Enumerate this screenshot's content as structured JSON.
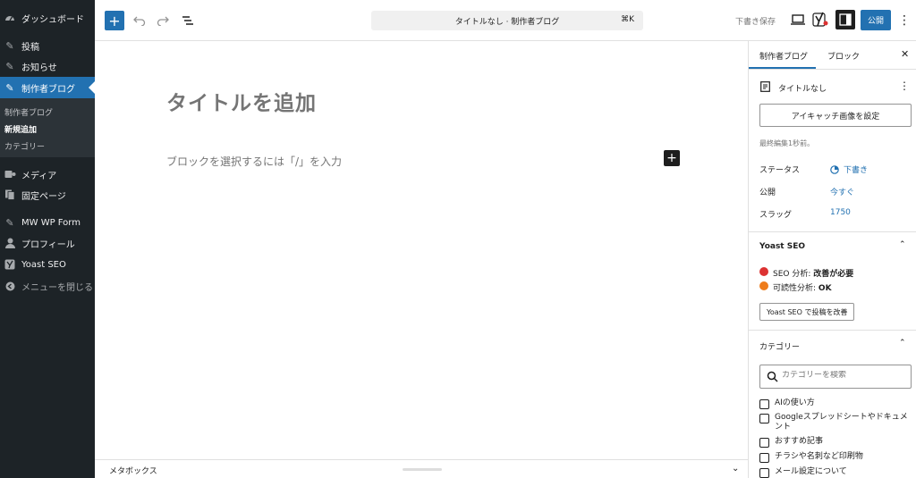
{
  "admin_menu": {
    "items": [
      {
        "label": "ダッシュボード",
        "icon": "dashboard-icon"
      },
      {
        "label": "投稿",
        "icon": "pin-icon"
      },
      {
        "label": "お知らせ",
        "icon": "pin-icon"
      },
      {
        "label": "制作者ブログ",
        "icon": "pin-icon",
        "active": true
      },
      {
        "label": "メディア",
        "icon": "media-icon"
      },
      {
        "label": "固定ページ",
        "icon": "page-icon"
      },
      {
        "label": "MW WP Form",
        "icon": "pin-icon"
      },
      {
        "label": "プロフィール",
        "icon": "user-icon"
      },
      {
        "label": "Yoast SEO",
        "icon": "yoast-icon"
      },
      {
        "label": "メニューを閉じる",
        "icon": "collapse-icon"
      }
    ],
    "submenu": [
      {
        "label": "制作者ブログ"
      },
      {
        "label": "新規追加",
        "current": true
      },
      {
        "label": "カテゴリー"
      }
    ]
  },
  "toolbar": {
    "document_title": "タイトルなし · 制作者ブログ",
    "shortcut": "⌘K",
    "save_draft": "下書き保存",
    "publish": "公開"
  },
  "canvas": {
    "title_placeholder": "タイトルを追加",
    "block_placeholder": "ブロックを選択するには「/」を入力"
  },
  "metabox": {
    "label": "メタボックス"
  },
  "sidebar": {
    "tabs": [
      "制作者ブログ",
      "ブロック"
    ],
    "post_title": "タイトルなし",
    "featured_image_button": "アイキャッチ画像を設定",
    "last_edited": "最終編集1秒前。",
    "status_label": "ステータス",
    "status_value": "下書き",
    "publish_label": "公開",
    "publish_value": "今すぐ",
    "slug_label": "スラッグ",
    "slug_value": "1750",
    "yoast": {
      "title": "Yoast SEO",
      "seo_label": "SEO 分析:",
      "seo_value": "改善が必要",
      "readability_label": "可読性分析:",
      "readability_value": "OK",
      "improve_button": "Yoast SEO で投稿を改善",
      "seo_color": "#dc3232",
      "readability_color": "#ee7c1b"
    },
    "categories": {
      "title": "カテゴリー",
      "search_placeholder": "カテゴリーを検索",
      "items": [
        {
          "label": "AIの使い方"
        },
        {
          "label": "Googleスプレッドシートやドキュメント"
        },
        {
          "label": "おすすめ記事"
        },
        {
          "label": "チラシや名刺など印刷物"
        },
        {
          "label": "メール設定について"
        }
      ]
    }
  },
  "colors": {
    "accent": "#2271b1",
    "admin_bg": "#1d2327"
  }
}
